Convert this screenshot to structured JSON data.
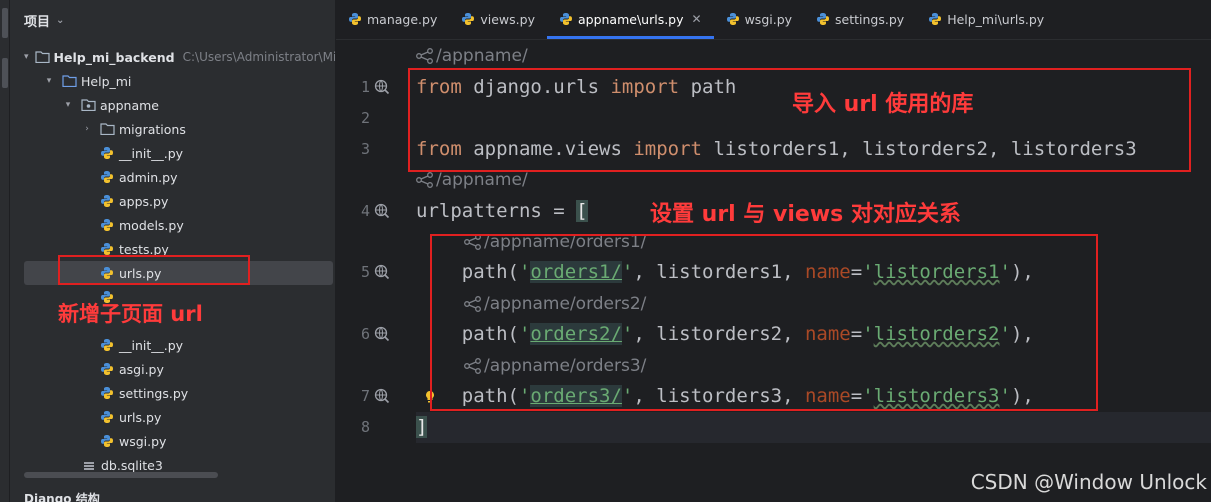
{
  "project_panel": {
    "title": "项目",
    "tree": [
      {
        "label": "Help_mi_backend",
        "path": "C:\\Users\\Administrator\\Min",
        "icon": "folder-icon"
      },
      {
        "label": "Help_mi",
        "icon": "folder-icon"
      },
      {
        "label": "appname",
        "icon": "package-folder-icon"
      },
      {
        "label": "migrations",
        "icon": "folder-icon"
      },
      {
        "label": "__init__.py",
        "icon": "python-file-icon"
      },
      {
        "label": "admin.py",
        "icon": "python-file-icon"
      },
      {
        "label": "apps.py",
        "icon": "python-file-icon"
      },
      {
        "label": "models.py",
        "icon": "python-file-icon"
      },
      {
        "label": "tests.py",
        "icon": "python-file-icon"
      },
      {
        "label": "urls.py",
        "icon": "python-file-icon"
      },
      {
        "label": "__init__.py",
        "icon": "python-file-icon"
      },
      {
        "label": "asgi.py",
        "icon": "python-file-icon"
      },
      {
        "label": "settings.py",
        "icon": "python-file-icon"
      },
      {
        "label": "urls.py",
        "icon": "python-file-icon"
      },
      {
        "label": "wsgi.py",
        "icon": "python-file-icon"
      },
      {
        "label": "db.sqlite3",
        "icon": "database-file-icon"
      }
    ],
    "bottom_panel_title": "Django 结构"
  },
  "tabs": [
    {
      "label": "manage.py",
      "active": false
    },
    {
      "label": "views.py",
      "active": false
    },
    {
      "label": "appname\\urls.py",
      "active": true
    },
    {
      "label": "wsgi.py",
      "active": false
    },
    {
      "label": "settings.py",
      "active": false
    },
    {
      "label": "Help_mi\\urls.py",
      "active": false
    }
  ],
  "editor": {
    "line_numbers": [
      "1",
      "2",
      "3",
      "4",
      "5",
      "6",
      "7",
      "8"
    ],
    "hints": {
      "h0": "/appname/",
      "h1": "/appname/",
      "h2": "/appname/orders1/",
      "h3": "/appname/orders2/",
      "h4": "/appname/orders3/"
    },
    "code": {
      "l1": {
        "kw1": "from",
        "mod": " django.urls ",
        "kw2": "import",
        "name": " path"
      },
      "l3": {
        "kw1": "from",
        "mod": " appname.views ",
        "kw2": "import",
        "names": " listorders1, listorders2, listorders3"
      },
      "l4": {
        "var": "urlpatterns = ",
        "bracket": "["
      },
      "l5": {
        "pre": "    path(",
        "q1": "'",
        "route": "orders1/",
        "q2": "'",
        "mid": ", listorders1, ",
        "param": "name",
        "eq": "=",
        "q3": "'",
        "sval": "listorders1",
        "q4": "'",
        "end": "),"
      },
      "l6": {
        "pre": "    path(",
        "q1": "'",
        "route": "orders2/",
        "q2": "'",
        "mid": ", listorders2, ",
        "param": "name",
        "eq": "=",
        "q3": "'",
        "sval": "listorders2",
        "q4": "'",
        "end": "),"
      },
      "l7": {
        "pre": "    path(",
        "q1": "'",
        "route": "orders3/",
        "q2": "'",
        "mid": ", listorders3, ",
        "param": "name",
        "eq": "=",
        "q3": "'",
        "sval": "listorders3",
        "q4": "'",
        "end": "),"
      },
      "l8": {
        "bracket": "]"
      }
    }
  },
  "annotations": {
    "import_note": "导入 url 使用的库",
    "mapping_note": "设置 url 与 views 对对应关系",
    "new_page_note": "新增子页面 url"
  },
  "watermark": "CSDN @Window Unlock",
  "colors": {
    "annotation_red": "#e02020",
    "keyword": "#cf8e6d",
    "string": "#6aab73",
    "accent": "#3574f0"
  }
}
